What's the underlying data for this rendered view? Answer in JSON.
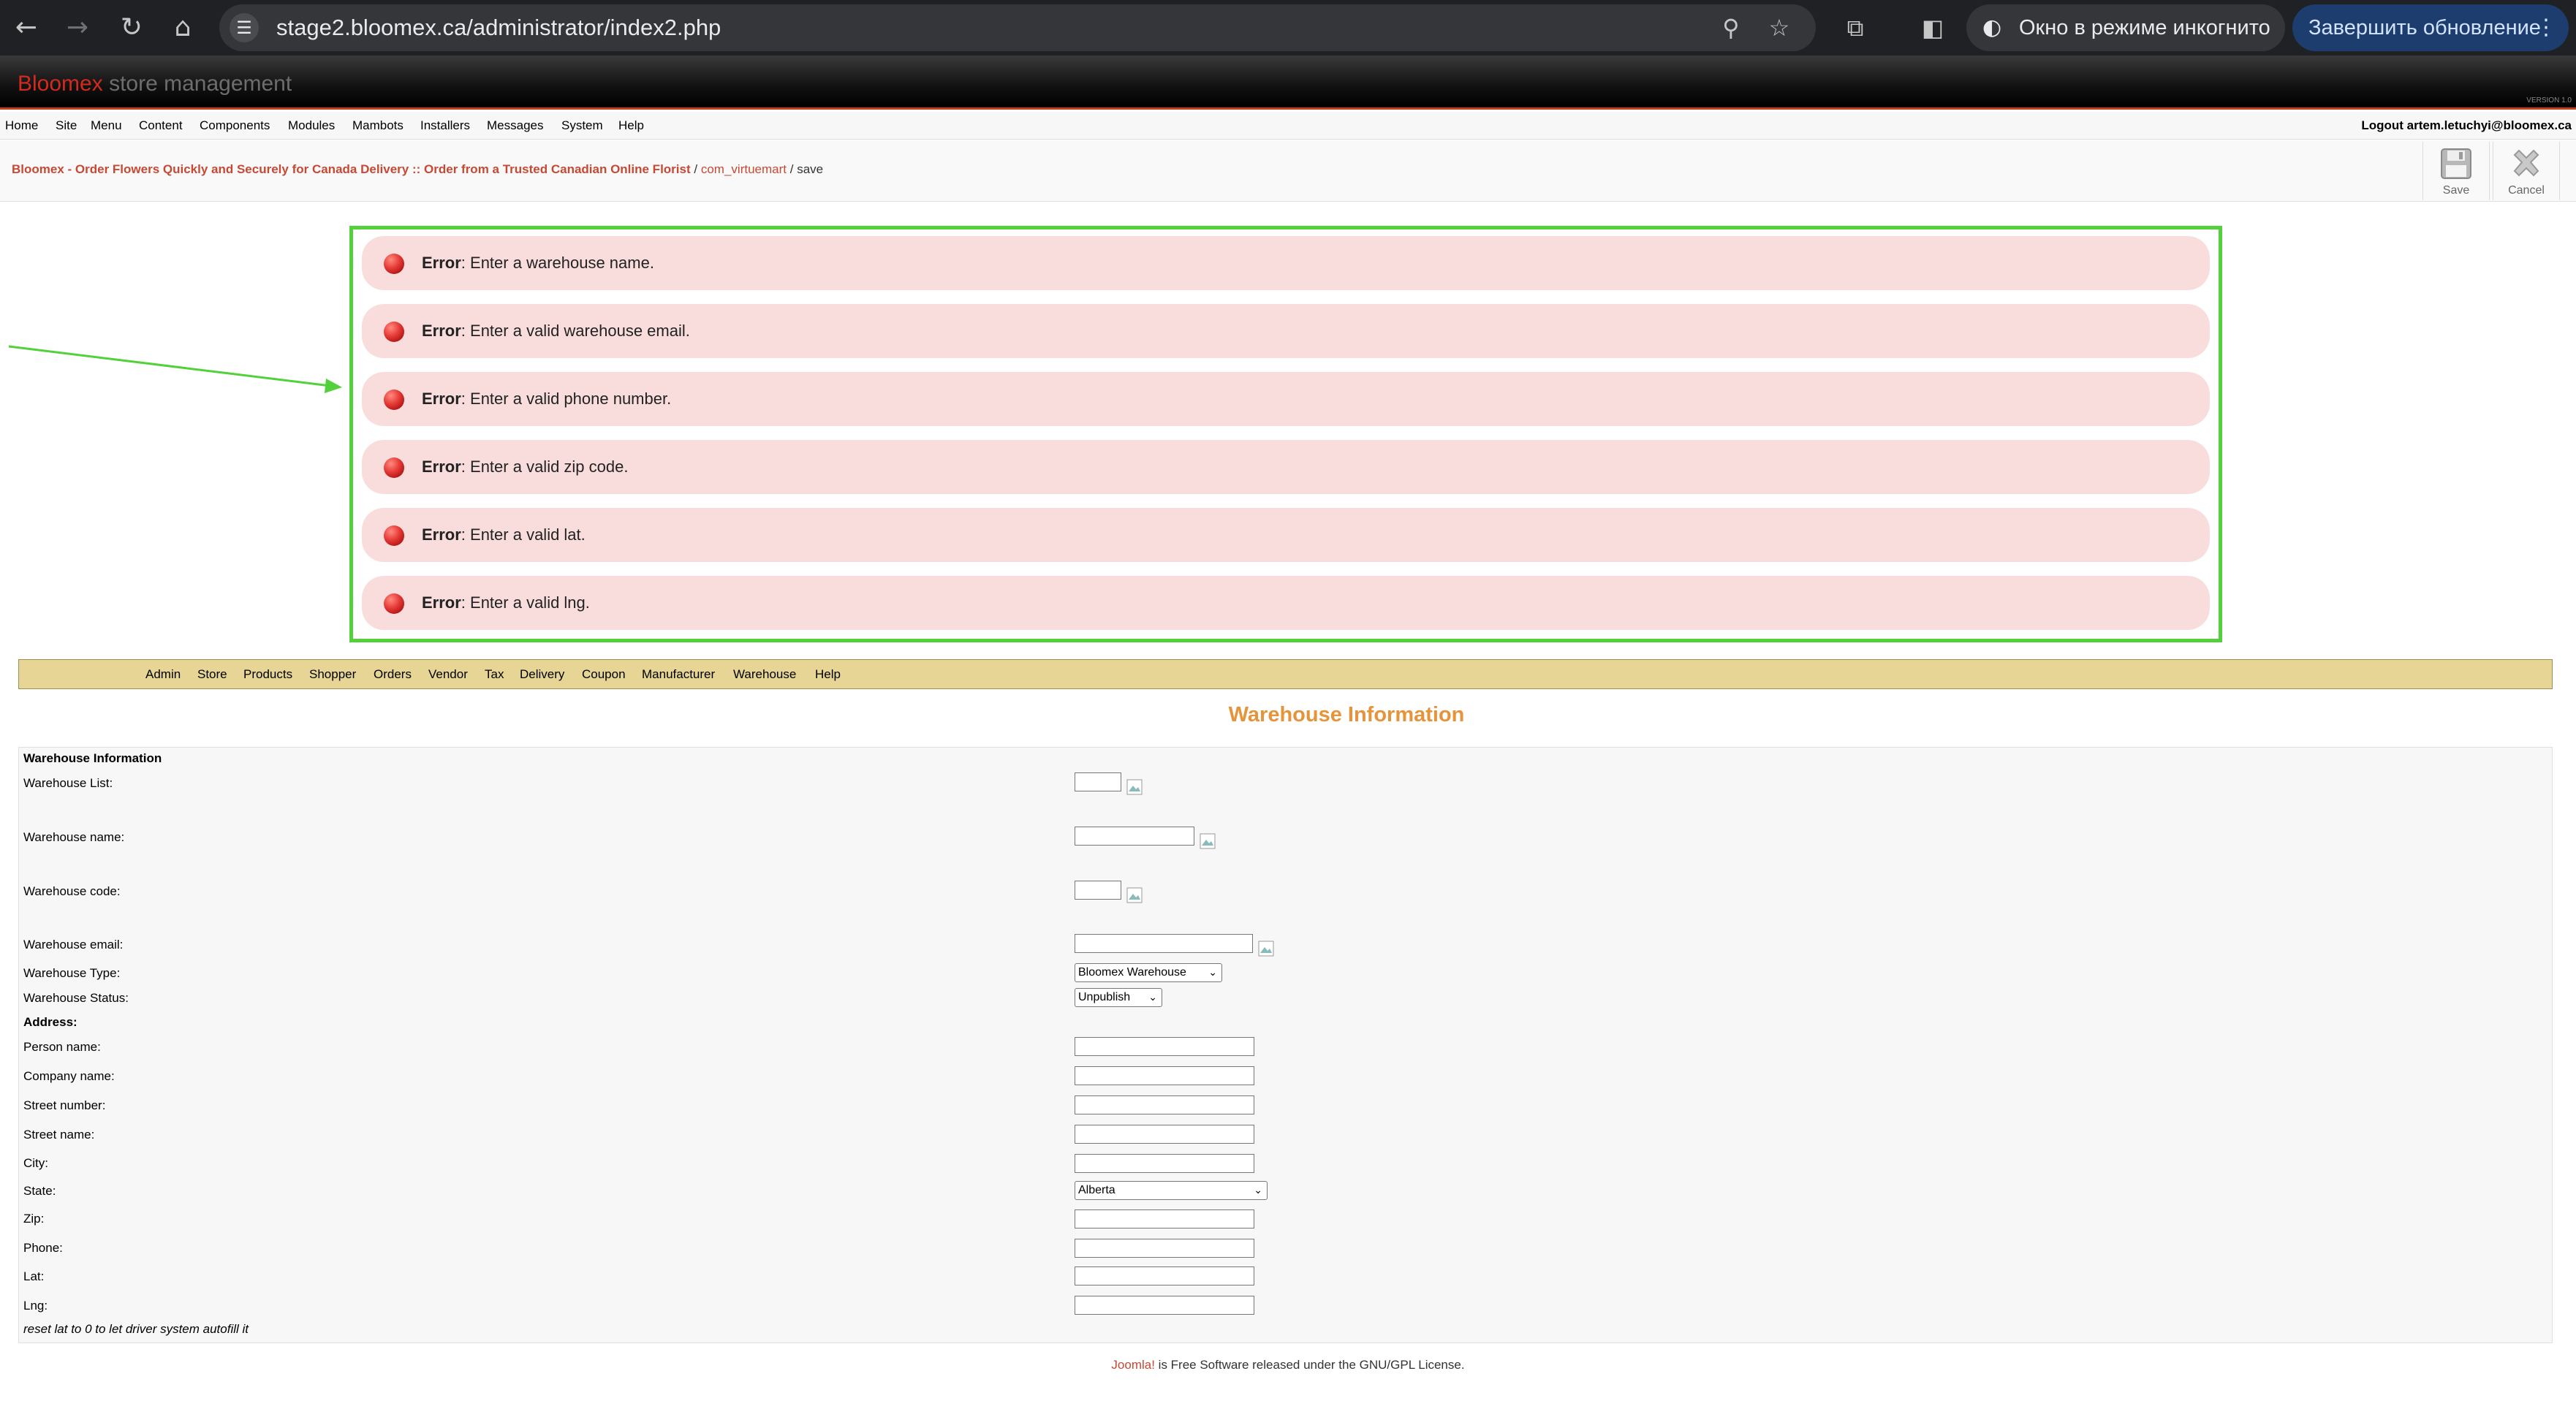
{
  "browser": {
    "url": "stage2.bloomex.ca/administrator/index2.php",
    "incognito_label": "Окно в режиме инкогнито",
    "update_label": "Завершить обновление"
  },
  "header": {
    "brand": "Bloomex",
    "subtitle": "store management",
    "version": "VERSION 1.0"
  },
  "menu": {
    "items": [
      "Home",
      "Site",
      "Menu",
      "Content",
      "Components",
      "Modules",
      "Mambots",
      "Installers",
      "Messages",
      "System",
      "Help"
    ],
    "logout": "Logout artem.letuchyi@bloomex.ca"
  },
  "pathway": {
    "site": "Bloomex - Order Flowers Quickly and Securely for Canada Delivery :: Order from a Trusted Canadian Online Florist",
    "sep": "/",
    "component": "com_virtuemart",
    "task": "save"
  },
  "toolbar": {
    "save_label": "Save",
    "cancel_label": "Cancel"
  },
  "errors": {
    "prefix": "Error",
    "messages": [
      ": Enter a warehouse name.",
      ": Enter a valid warehouse email.",
      ": Enter a valid phone number.",
      ": Enter a valid zip code.",
      ": Enter a valid lat.",
      ": Enter a valid lng."
    ]
  },
  "vm_menu": {
    "items": [
      "Admin",
      "Store",
      "Products",
      "Shopper",
      "Orders",
      "Vendor",
      "Tax",
      "Delivery",
      "Coupon",
      "Manufacturer",
      "Warehouse",
      "Help"
    ]
  },
  "page": {
    "title": "Warehouse Information"
  },
  "form": {
    "section_title": "Warehouse Information",
    "warehouse_list_label": "Warehouse List:",
    "warehouse_name_label": "Warehouse name:",
    "warehouse_code_label": "Warehouse code:",
    "warehouse_email_label": "Warehouse email:",
    "warehouse_type_label": "Warehouse Type:",
    "warehouse_type_value": "Bloomex Warehouse",
    "warehouse_status_label": "Warehouse Status:",
    "warehouse_status_value": "Unpublish",
    "address_label": "Address:",
    "person_name_label": "Person name:",
    "company_name_label": "Company name:",
    "street_number_label": "Street number:",
    "street_name_label": "Street name:",
    "city_label": "City:",
    "state_label": "State:",
    "state_value": "Alberta",
    "zip_label": "Zip:",
    "phone_label": "Phone:",
    "lat_label": "Lat:",
    "lng_label": "Lng:",
    "hint": "reset lat to 0 to let driver system autofill it"
  },
  "footer": {
    "joomla": "Joomla!",
    "text": " is Free Software released under the GNU/GPL License."
  }
}
